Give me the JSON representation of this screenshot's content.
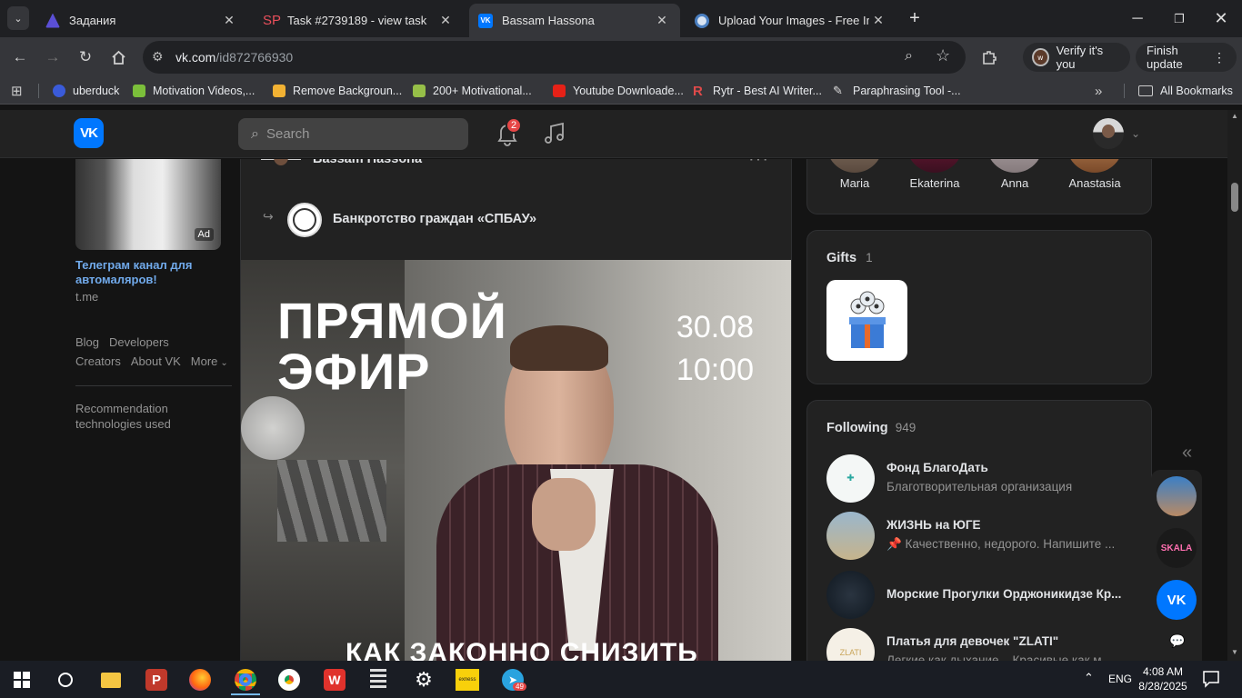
{
  "browser": {
    "tabs": [
      {
        "title": "Задания",
        "favicon": "zadaniya-icon",
        "active": false
      },
      {
        "title": "Task #2739189 - view task",
        "favicon": "sp-icon",
        "active": false
      },
      {
        "title": "Bassam Hassona",
        "favicon": "vk-icon",
        "active": true
      },
      {
        "title": "Upload Your Images - Free Imag",
        "favicon": "upload-icon",
        "active": false
      }
    ],
    "url_host": "vk.com",
    "url_path": "/id872766930",
    "verify_label": "Verify it's you",
    "finish_update_label": "Finish update",
    "bookmarks": [
      {
        "label": "uberduck",
        "color": "#3a5bd9"
      },
      {
        "label": "Motivation Videos,...",
        "color": "#7bbf3a"
      },
      {
        "label": "Remove Backgroun...",
        "color": "#f2b233"
      },
      {
        "label": "200+ Motivational...",
        "color": "#96bf48"
      },
      {
        "label": "Youtube Downloade...",
        "color": "#e62117"
      },
      {
        "label": "Rytr - Best AI Writer...",
        "color": "#e04a4a"
      },
      {
        "label": "Paraphrasing Tool -...",
        "color": "#cccccc"
      }
    ],
    "all_bookmarks_label": "All Bookmarks"
  },
  "vk": {
    "logo_text": "VK",
    "search_placeholder": "Search",
    "notification_count": "2",
    "ad": {
      "badge": "Ad",
      "title": "Телеграм канал для автомаляров!",
      "domain": "t.me"
    },
    "footer_links": [
      "Blog",
      "Developers",
      "Creators",
      "About VK",
      "More"
    ],
    "recommendation_note": "Recommendation technologies used",
    "post": {
      "author": "Bassam Hassona",
      "repost_from": "Банкротство граждан «СПБАУ»",
      "image_title_line1": "ПРЯМОЙ",
      "image_title_line2": "ЭФИР",
      "image_date": "30.08",
      "image_time": "10:00",
      "image_bottom": "КАК ЗАКОННО СНИЗИТЬ"
    },
    "friends": [
      "Maria",
      "Ekaterina",
      "Anna",
      "Anastasia"
    ],
    "gifts": {
      "label": "Gifts",
      "count": "1"
    },
    "following": {
      "label": "Following",
      "count": "949",
      "items": [
        {
          "name": "Фонд БлагоДать",
          "desc": "Благотворительная организация"
        },
        {
          "name": "ЖИЗНЬ на ЮГЕ",
          "desc": "📌 Качественно, недорого. Напишите ..."
        },
        {
          "name": "Морские Прогулки Орджоникидзе Кр...",
          "desc": ""
        },
        {
          "name": "Платья для девочек \"ZLATI\"",
          "desc": "Легкие как дыхание... Красивые как м..."
        }
      ]
    },
    "chat_badges": [
      "SKALA"
    ]
  },
  "taskbar": {
    "time": "4:08 AM",
    "date": "8/28/2025",
    "language": "ENG",
    "telegram_badge": "49",
    "exness_label": "exness"
  }
}
